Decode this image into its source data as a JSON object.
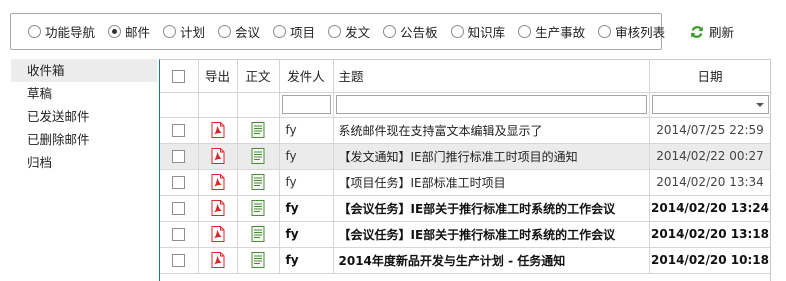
{
  "nav": {
    "options": [
      {
        "label": "功能导航",
        "checked": false
      },
      {
        "label": "邮件",
        "checked": true
      },
      {
        "label": "计划",
        "checked": false
      },
      {
        "label": "会议",
        "checked": false
      },
      {
        "label": "项目",
        "checked": false
      },
      {
        "label": "发文",
        "checked": false
      },
      {
        "label": "公告板",
        "checked": false
      },
      {
        "label": "知识库",
        "checked": false
      },
      {
        "label": "生产事故",
        "checked": false
      },
      {
        "label": "审核列表",
        "checked": false
      }
    ],
    "refresh_label": "刷新"
  },
  "folders": [
    {
      "label": "收件箱",
      "active": true
    },
    {
      "label": "草稿",
      "active": false
    },
    {
      "label": "已发送邮件",
      "active": false
    },
    {
      "label": "已删除邮件",
      "active": false
    },
    {
      "label": "归档",
      "active": false
    }
  ],
  "table": {
    "headers": {
      "export": "导出",
      "body": "正文",
      "sender": "发件人",
      "subject": "主题",
      "date": "日期"
    },
    "rows": [
      {
        "sender": "fy",
        "subject": "系统邮件现在支持富文本编辑及显示了",
        "date": "2014/07/25 22:59",
        "bold": false,
        "selected": false
      },
      {
        "sender": "fy",
        "subject": "【发文通知】IE部门推行标准工时项目的通知",
        "date": "2014/02/22 00:27",
        "bold": false,
        "selected": true
      },
      {
        "sender": "fy",
        "subject": "【项目任务】IE部标准工时项目",
        "date": "2014/02/20 13:34",
        "bold": false,
        "selected": false
      },
      {
        "sender": "fy",
        "subject": "【会议任务】IE部关于推行标准工时系统的工作会议",
        "date": "2014/02/20 13:24",
        "bold": true,
        "selected": false
      },
      {
        "sender": "fy",
        "subject": "【会议任务】IE部关于推行标准工时系统的工作会议",
        "date": "2014/02/20 13:18",
        "bold": true,
        "selected": false
      },
      {
        "sender": "fy",
        "subject": "2014年度新品开发与生产计划 - 任务通知",
        "date": "2014/02/20 10:18",
        "bold": true,
        "selected": false
      }
    ]
  },
  "colors": {
    "pdf_icon": "#d9262b",
    "doc_icon": "#4a8a3a",
    "refresh_icon": "#3a9a2a",
    "selected_row": "#ebebeb",
    "table_left_border": "#1f6fbf"
  }
}
